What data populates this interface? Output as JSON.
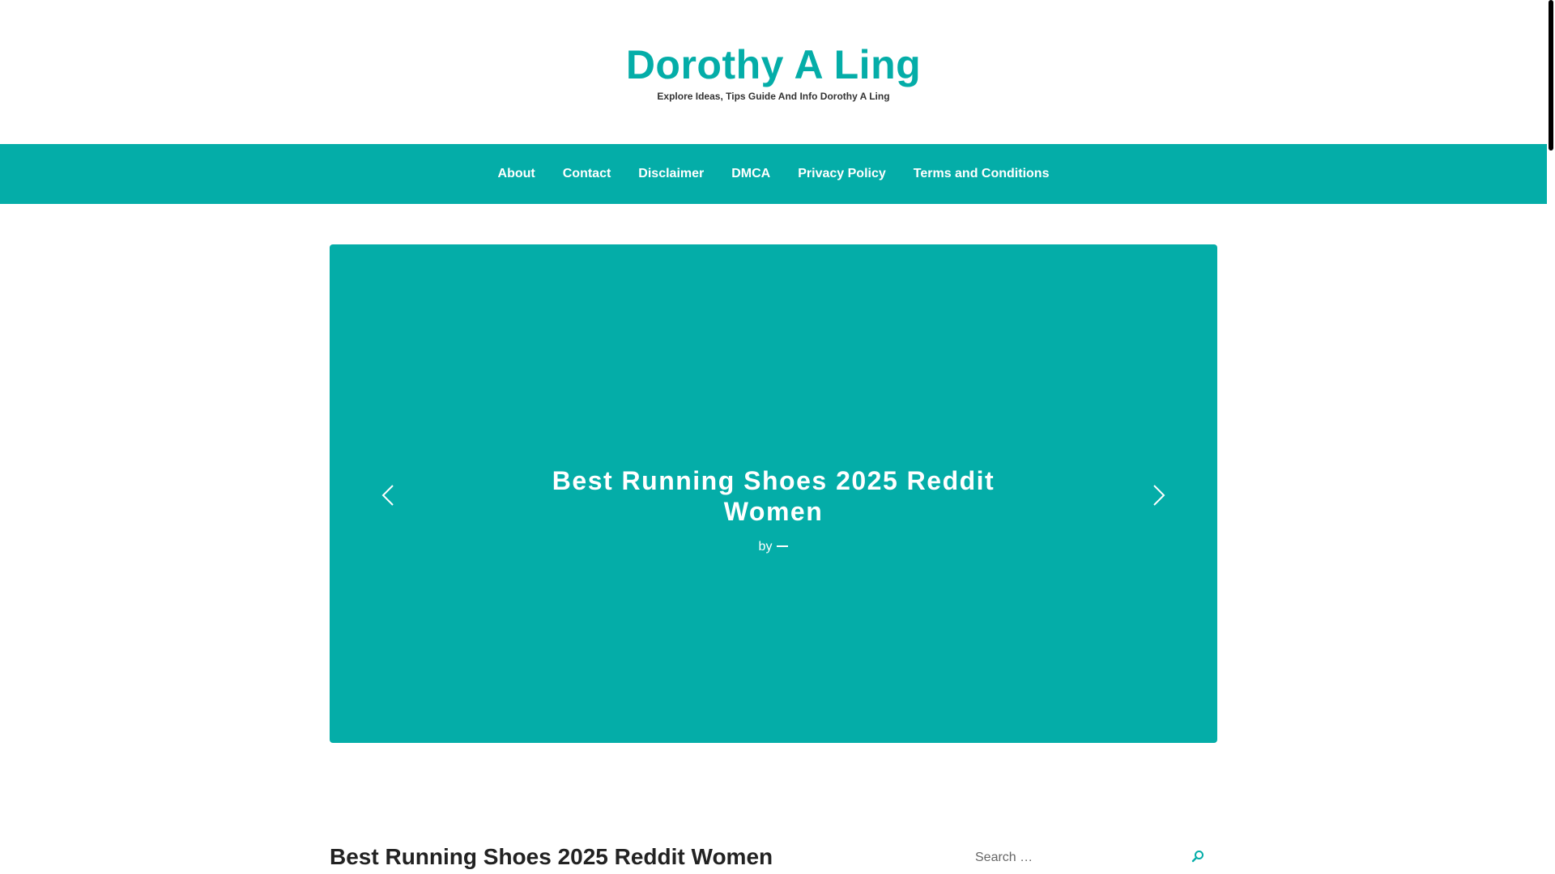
{
  "site": {
    "title": "Dorothy A Ling",
    "tagline": "Explore Ideas, Tips Guide And Info Dorothy A Ling"
  },
  "nav": {
    "items": [
      {
        "label": "About"
      },
      {
        "label": "Contact"
      },
      {
        "label": "Disclaimer"
      },
      {
        "label": "DMCA"
      },
      {
        "label": "Privacy Policy"
      },
      {
        "label": "Terms and Conditions"
      }
    ]
  },
  "slider": {
    "title": "Best Running Shoes 2025 Reddit Women",
    "byline": "by",
    "prev_icon": "chevron-left-icon",
    "next_icon": "chevron-right-icon"
  },
  "post": {
    "title": "Best Running Shoes 2025 Reddit Women"
  },
  "search": {
    "placeholder": "Search …",
    "icon": "search-icon"
  },
  "colors": {
    "accent": "#04ada8",
    "text": "#222222",
    "background": "#ffffff"
  }
}
